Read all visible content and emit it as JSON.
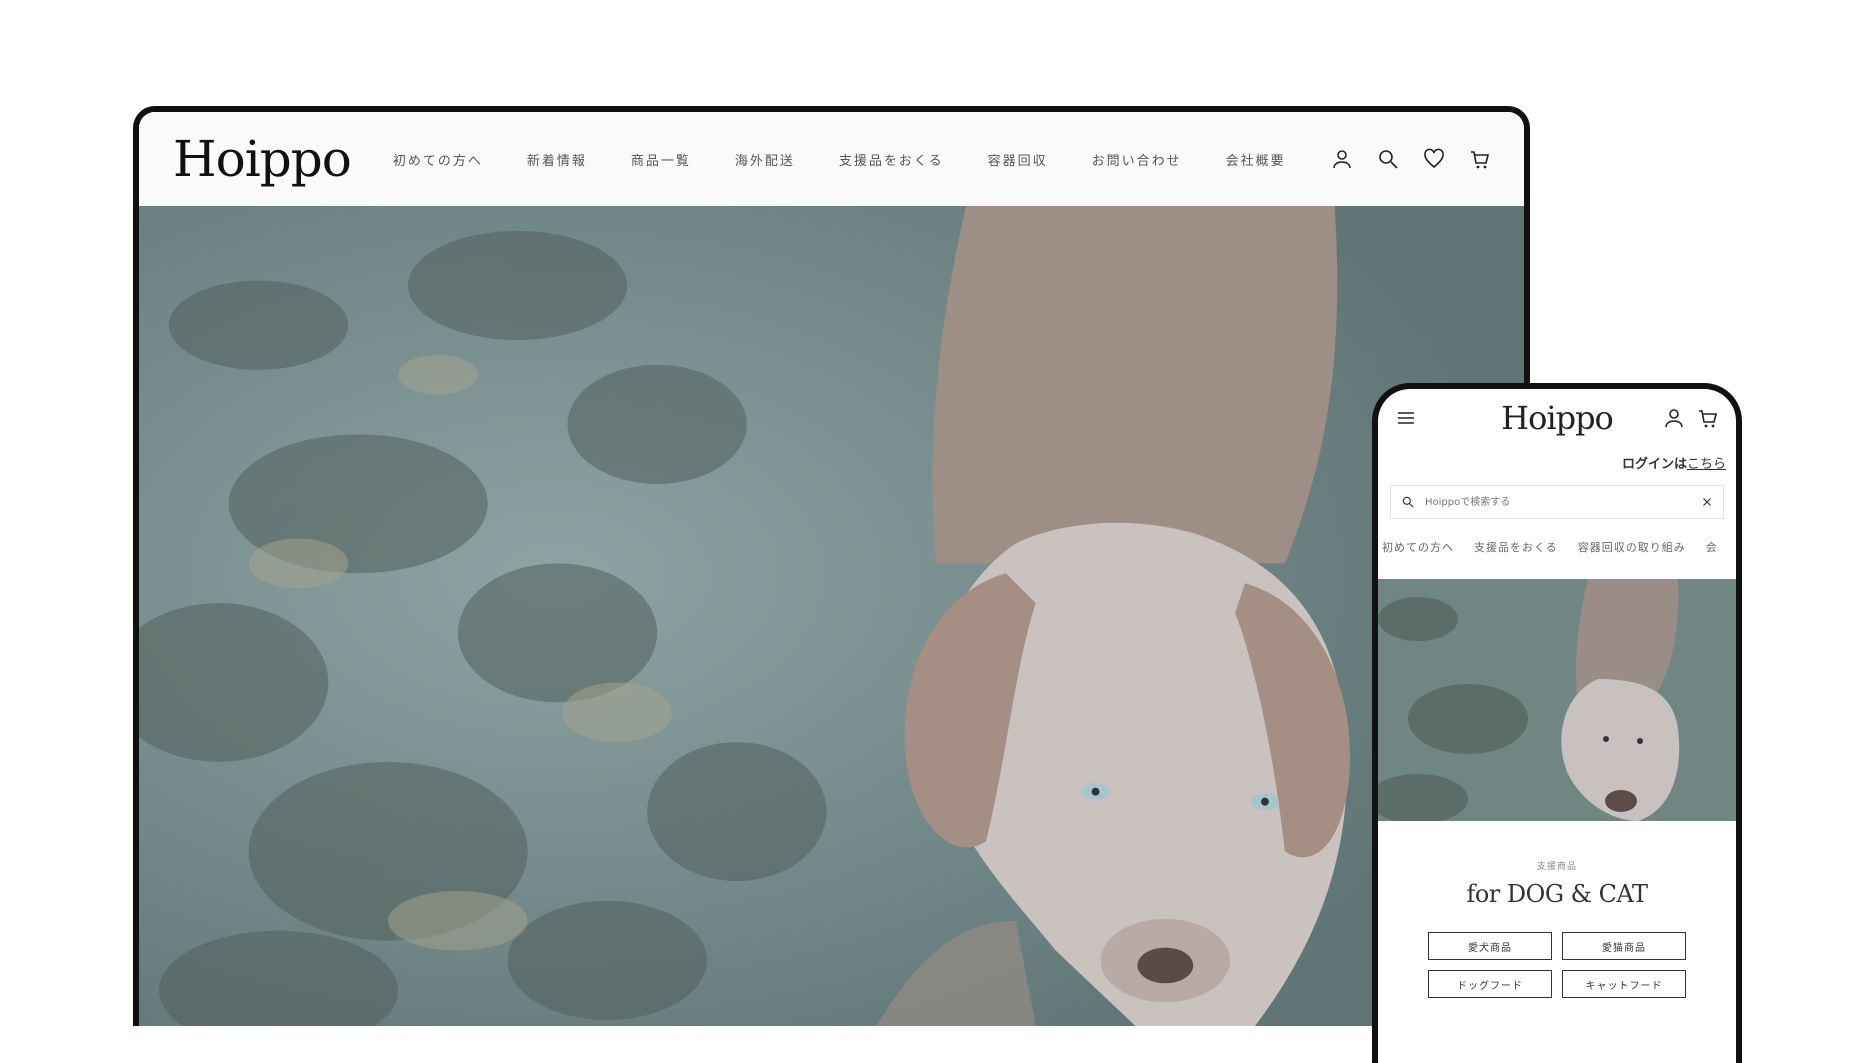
{
  "desktop": {
    "logo": "Hoippo",
    "nav": [
      "初めての方へ",
      "新着情報",
      "商品一覧",
      "海外配送",
      "支援品をおくる",
      "容器回収",
      "お問い合わせ",
      "会社概要"
    ],
    "icons": [
      "account-icon",
      "search-icon",
      "heart-icon",
      "cart-icon"
    ]
  },
  "mobile": {
    "logo": "Hoippo",
    "login_prefix": "ログインは",
    "login_link": "こちら",
    "search_placeholder": "Hoippoで検索する",
    "tabs": [
      "初めての方へ",
      "支援品をおくる",
      "容器回収の取り組み",
      "会"
    ],
    "section_kicker": "支援商品",
    "section_title": "for DOG & CAT",
    "buttons": [
      "愛犬商品",
      "愛猫商品",
      "ドッグフード",
      "キャットフード"
    ]
  },
  "colors": {
    "frame": "#111111",
    "header_bg": "#fafafa",
    "water": "#6f8c8c",
    "dog": "#a79f9b"
  }
}
